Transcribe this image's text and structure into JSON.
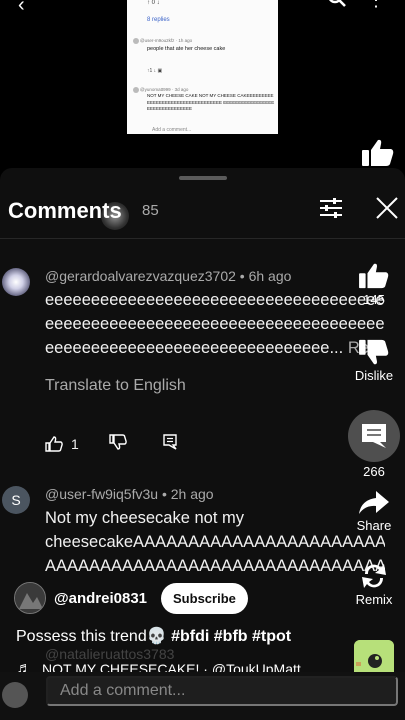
{
  "video": {
    "embed": {
      "vote_count": "↑ 0  ↓",
      "replies": "8 replies",
      "comment1_head": "@user-m9ou2kfz · 1h ago",
      "comment1_text": "people that ate her cheese cake",
      "comment1_actions": "↑1   ↓   ▣",
      "comment2_head": "@yunomatt999 · 3d ago",
      "comment2_text": "NOT MY CHEESE CAKE NOT MY CHEESE CAKEEEEEEEEEEEEEEEEEEEEEEEEEEEEEEEEEE EEEEEEEEEEEEEEEEEEEEEEEEEEEEEEEE",
      "add_placeholder": "Add a comment..."
    }
  },
  "sheet": {
    "title": "Comments",
    "count": "85"
  },
  "comments": [
    {
      "author": "@gerardoalvarezvazquez3702",
      "time": "6h ago",
      "line1": "eeeeeeeeeeeeeeeeeeeeeeeeeeeeeeeeeeeeeeeeeeeeee",
      "line2": "eeeeeeeeeeeeeeeeeeeeeeeeeeeeeeeeeeeeeeeeeeeeee",
      "line3": "eeeeeeeeeeeeeeeeeeeeeeeeeeeeeee...",
      "read_more": " Read more",
      "translate": "Translate to English",
      "likes": "1"
    },
    {
      "avatar_letter": "S",
      "author": "@user-fw9iq5fv3u",
      "time": "2h ago",
      "line1": "Not my cheesecake not my",
      "line2": "cheesecakeAAAAAAAAAAAAAAAAAAAAAAAAA",
      "line3": "AAAAAAAAAAAAAAAAAAAAAAAAAAAAAAAA"
    },
    {
      "author": "@natalieruattos3783"
    }
  ],
  "rail": {
    "like_count": "145",
    "dislike_label": "Dislike",
    "comments_count": "266",
    "share_label": "Share",
    "remix_label": "Remix"
  },
  "channel": {
    "name": "@andrei0831",
    "subscribe_label": "Subscribe"
  },
  "caption": {
    "text": "Possess this trend",
    "emoji": "💀",
    "tags": " #bfdi #bfb #tpot"
  },
  "music": {
    "text": "NOT MY CHEESECAKE! · @ToukUpMatt"
  },
  "add_comment": {
    "placeholder": "Add a comment..."
  },
  "colors": {
    "sheet_bg": "#0f0f0f",
    "secondary_text": "#aaaaaa",
    "sound_thumb": "#b7e07a"
  }
}
